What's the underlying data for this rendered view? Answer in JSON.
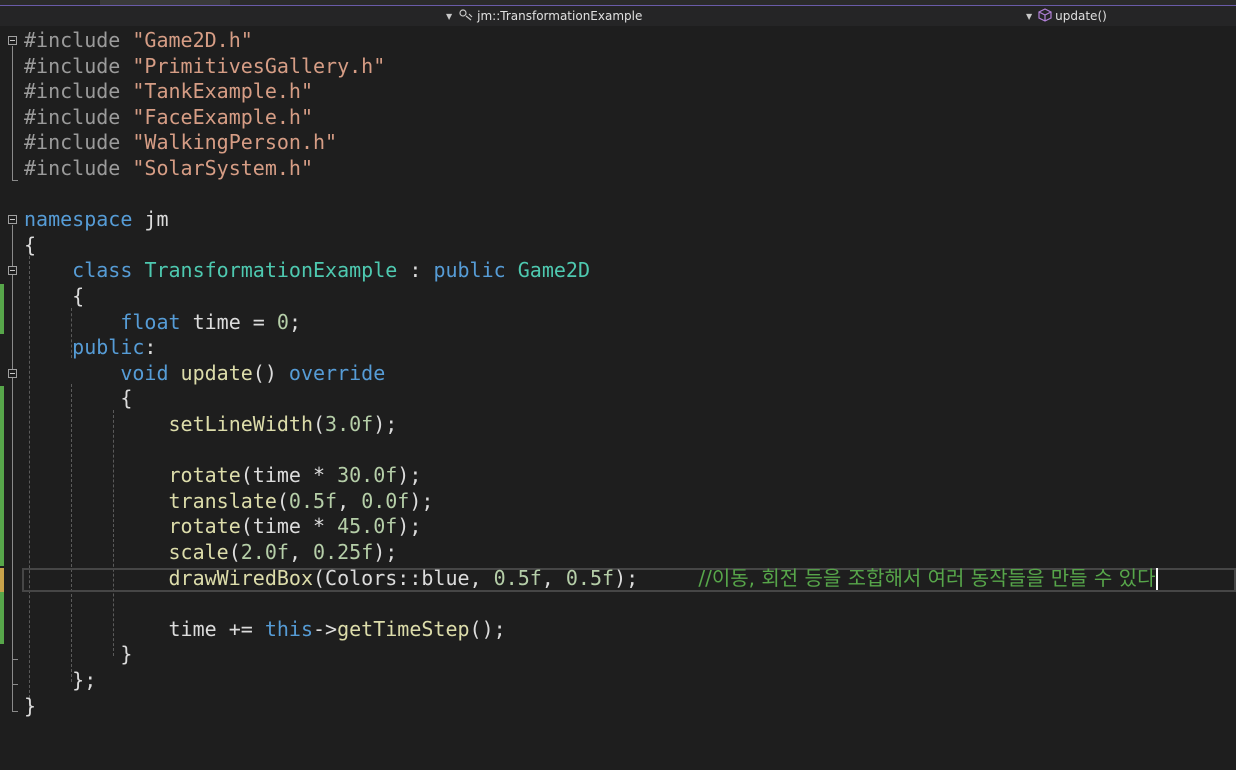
{
  "navbar": {
    "class_scope": "jm::TransformationExample",
    "member_scope": "update()",
    "class_icon": "class-members-icon",
    "member_icon": "method-cube-icon"
  },
  "colors": {
    "background": "#1e1e1e",
    "keyword": "#569cd6",
    "string": "#d69d85",
    "type": "#4ec9b0",
    "function": "#dcdcaa",
    "number": "#b5cea8",
    "comment": "#57a64a"
  },
  "code": {
    "l1": {
      "directive": "#include",
      "space": " ",
      "file": "\"Game2D.h\""
    },
    "l2": {
      "directive": "#include",
      "space": " ",
      "file": "\"PrimitivesGallery.h\""
    },
    "l3": {
      "directive": "#include",
      "space": " ",
      "file": "\"TankExample.h\""
    },
    "l4": {
      "directive": "#include",
      "space": " ",
      "file": "\"FaceExample.h\""
    },
    "l5": {
      "directive": "#include",
      "space": " ",
      "file": "\"WalkingPerson.h\""
    },
    "l6": {
      "directive": "#include",
      "space": " ",
      "file": "\"SolarSystem.h\""
    },
    "l8": {
      "kw": "namespace",
      "sp": " ",
      "name": "jm"
    },
    "l9": {
      "text": "{"
    },
    "l10": {
      "indent": "    ",
      "kw": "class",
      "sp": " ",
      "name": "TransformationExample",
      "sep": " : ",
      "kw2": "public",
      "sp2": " ",
      "base": "Game2D"
    },
    "l11": {
      "indent": "    ",
      "text": "{"
    },
    "l12": {
      "indent": "        ",
      "kw": "float",
      "sp": " ",
      "rest": "time = ",
      "num": "0",
      "end": ";"
    },
    "l13": {
      "indent": "    ",
      "kw": "public",
      "end": ":"
    },
    "l14": {
      "indent": "        ",
      "kw": "void",
      "sp": " ",
      "fn": "update",
      "mid": "() ",
      "kw2": "override"
    },
    "l15": {
      "indent": "        ",
      "text": "{"
    },
    "l16": {
      "indent": "            ",
      "fn": "setLineWidth",
      "open": "(",
      "num": "3.0f",
      "close": ");"
    },
    "l18": {
      "indent": "            ",
      "fn": "rotate",
      "open": "(time * ",
      "num": "30.0f",
      "close": ");"
    },
    "l19": {
      "indent": "            ",
      "fn": "translate",
      "open": "(",
      "num1": "0.5f",
      "comma": ", ",
      "num2": "0.0f",
      "close": ");"
    },
    "l20": {
      "indent": "            ",
      "fn": "rotate",
      "open": "(time * ",
      "num": "45.0f",
      "close": ");"
    },
    "l21": {
      "indent": "            ",
      "fn": "scale",
      "open": "(",
      "num1": "2.0f",
      "comma": ", ",
      "num2": "0.25f",
      "close": ");"
    },
    "l22": {
      "indent": "            ",
      "fn": "drawWiredBox",
      "open": "(",
      "arg": "Colors::blue, ",
      "num1": "0.5f",
      "comma": ", ",
      "num2": "0.5f",
      "close": ");",
      "gap": "     ",
      "comment": "//이동, 회전 등을 조합해서 여러 동작들을 만들 수 있다"
    },
    "l24": {
      "indent": "            ",
      "rest": "time += ",
      "kw": "this",
      "arrow": "->",
      "fn": "getTimeStep",
      "close": "();"
    },
    "l25": {
      "indent": "        ",
      "text": "}"
    },
    "l26": {
      "indent": "    ",
      "text": "};"
    },
    "l27": {
      "text": "}"
    }
  }
}
